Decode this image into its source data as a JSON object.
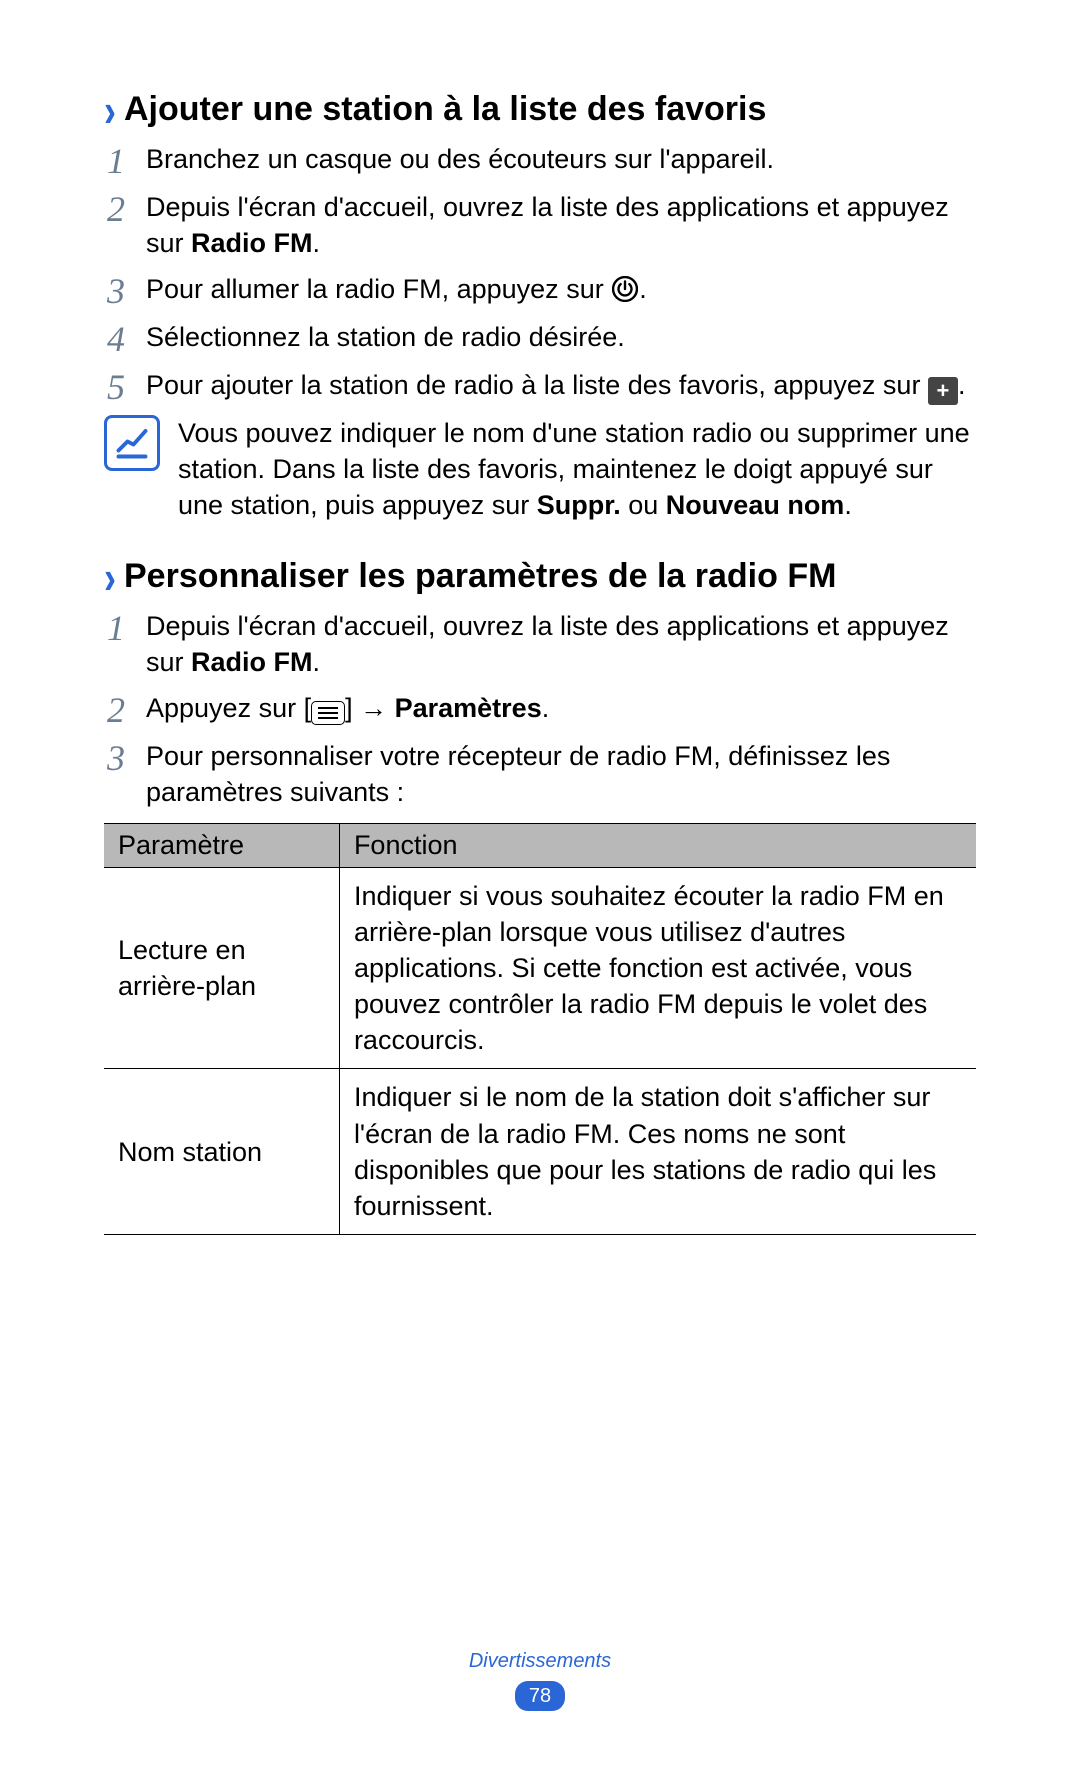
{
  "section1": {
    "title": "Ajouter une station à la liste des favoris",
    "steps": {
      "s1": "Branchez un casque ou des écouteurs sur l'appareil.",
      "s2_a": "Depuis l'écran d'accueil, ouvrez la liste des applications et appuyez sur ",
      "s2_b": "Radio FM",
      "s2_c": ".",
      "s3_a": "Pour allumer la radio FM, appuyez sur ",
      "s3_b": ".",
      "s4": "Sélectionnez la station de radio désirée.",
      "s5_a": "Pour ajouter la station de radio à la liste des favoris, appuyez sur ",
      "s5_b": "."
    },
    "note": {
      "a": "Vous pouvez indiquer le nom d'une station radio ou supprimer une station. Dans la liste des favoris, maintenez le doigt appuyé sur une station, puis appuyez sur ",
      "b": "Suppr.",
      "c": " ou ",
      "d": "Nouveau nom",
      "e": "."
    }
  },
  "section2": {
    "title": "Personnaliser les paramètres de la radio FM",
    "steps": {
      "s1_a": "Depuis l'écran d'accueil, ouvrez la liste des applications et appuyez sur ",
      "s1_b": "Radio FM",
      "s1_c": ".",
      "s2_a": "Appuyez sur [",
      "s2_b": "] → ",
      "s2_c": "Paramètres",
      "s2_d": ".",
      "s3": "Pour personnaliser votre récepteur de radio FM, définissez les paramètres suivants :"
    },
    "table": {
      "h1": "Paramètre",
      "h2": "Fonction",
      "rows": [
        {
          "param": "Lecture en arrière-plan",
          "fn": "Indiquer si vous souhaitez écouter la radio FM en arrière-plan lorsque vous utilisez d'autres applications. Si cette fonction est activée, vous pouvez contrôler la radio FM depuis le volet des raccourcis."
        },
        {
          "param": "Nom station",
          "fn": "Indiquer si le nom de la station doit s'afficher sur l'écran de la radio FM. Ces noms ne sont disponibles que pour les stations de radio qui les fournissent."
        }
      ]
    }
  },
  "footer": {
    "category": "Divertissements",
    "page": "78"
  },
  "nums": {
    "n1": "1",
    "n2": "2",
    "n3": "3",
    "n4": "4",
    "n5": "5"
  },
  "icons": {
    "plus": "+"
  }
}
